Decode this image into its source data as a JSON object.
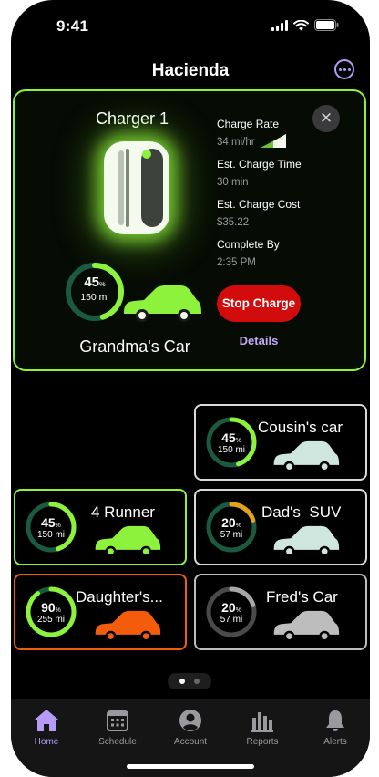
{
  "status_bar": {
    "time": "9:41"
  },
  "header": {
    "title": "Hacienda"
  },
  "main_card": {
    "charger_title": "Charger 1",
    "charge_rate_label": "Charge Rate",
    "charge_rate_value": "34 mi/hr",
    "charge_time_label": "Est. Charge Time",
    "charge_time_value": "30 min",
    "charge_cost_label": "Est. Charge Cost",
    "charge_cost_value": "$35.22",
    "complete_label": "Complete By",
    "complete_value": "2:35 PM",
    "stop_label": "Stop Charge",
    "details_label": "Details",
    "car_name": "Grandma's Car",
    "battery_pct": "45",
    "pct_unit": "%",
    "range": "150 mi",
    "battery_level": 0.45,
    "ring_color": "#8cf23b",
    "car_color": "#8cf23b"
  },
  "cars": [
    {
      "name": "Cousin's car",
      "pct": "45",
      "unit": "%",
      "range": "150 mi",
      "level": 0.45,
      "ring_color": "#8cf23b",
      "car_color": "#cfe6df",
      "border": "#d9d9d9"
    },
    {
      "name": "4 Runner",
      "pct": "45",
      "unit": "%",
      "range": "150 mi",
      "level": 0.45,
      "ring_color": "#8cf23b",
      "car_color": "#8cf23b",
      "border": "#8cf23b"
    },
    {
      "name": "Dad's  SUV",
      "pct": "20",
      "unit": "%",
      "range": "57 mi",
      "level": 0.2,
      "ring_color": "#e3a21a",
      "car_color": "#cfe6df",
      "border": "#d9d9d9"
    },
    {
      "name": "Daughter's...",
      "pct": "90",
      "unit": "%",
      "range": "255 mi",
      "level": 0.9,
      "ring_color": "#8cf23b",
      "car_color": "#f25c0a",
      "border": "#f25c0a"
    },
    {
      "name": "Fred's Car",
      "pct": "20",
      "unit": "%",
      "range": "57 mi",
      "level": 0.2,
      "ring_color": "#a8a8a8",
      "car_color": "#bdbdbd",
      "border": "#bdbdbd"
    }
  ],
  "pager": {
    "page": 1,
    "total": 2
  },
  "tabs": [
    {
      "label": "Home",
      "icon": "home-icon",
      "active": true
    },
    {
      "label": "Schedule",
      "icon": "calendar-icon",
      "active": false
    },
    {
      "label": "Account",
      "icon": "person-icon",
      "active": false
    },
    {
      "label": "Reports",
      "icon": "bar-chart-icon",
      "active": false
    },
    {
      "label": "Alerts",
      "icon": "bell-icon",
      "active": false
    }
  ],
  "colors": {
    "accent_green": "#8cf23b",
    "accent_purple": "#b59bf5",
    "stop_red": "#d20c0c",
    "orange": "#f25c0a"
  }
}
